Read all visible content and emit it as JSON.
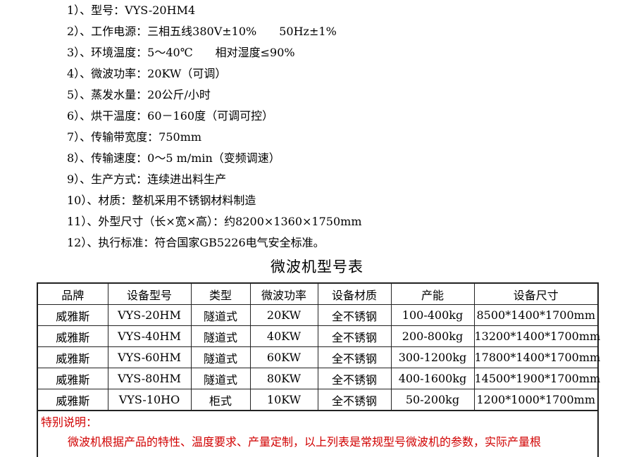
{
  "specs": [
    "1）、型号：VYS-20HM4",
    "2）、工作电源：三相五线380V±10%　　50Hz±1%",
    "3）、环境温度：5～40℃　　相对湿度≤90%",
    "4）、微波功率：20KW（可调）",
    "5）、蒸发水量：20公斤/小时",
    "6）、烘干温度：60－160度（可调可控）",
    "7）、传输带宽度：750mm",
    "8）、传输速度：0～5 m/min（变频调速）",
    "9）、生产方式：连续进出料生产",
    "10）、材质：整机采用不锈钢材料制造",
    "11）、外型尺寸（长×宽×高）：约8200×1360×1750mm",
    "12）、执行标准：符合国家GB5226电气安全标准。"
  ],
  "table_title": "微波机型号表",
  "table": {
    "headers": [
      "品牌",
      "设备型号",
      "类型",
      "微波功率",
      "设备材质",
      "产能",
      "设备尺寸"
    ],
    "rows": [
      [
        "威雅斯",
        "VYS-20HM",
        "隧道式",
        "20KW",
        "全不锈钢",
        "100-400kg",
        "8500*1400*1700mm"
      ],
      [
        "威雅斯",
        "VYS-40HM",
        "隧道式",
        "40KW",
        "全不锈钢",
        "200-800kg",
        "13200*1400*1700mm"
      ],
      [
        "威雅斯",
        "VYS-60HM",
        "隧道式",
        "60KW",
        "全不锈钢",
        "300-1200kg",
        "17800*1400*1700mm"
      ],
      [
        "威雅斯",
        "VYS-80HM",
        "隧道式",
        "80KW",
        "全不锈钢",
        "400-1600kg",
        "14500*1900*1700mm"
      ],
      [
        "威雅斯",
        "VYS-10HO",
        "柜式",
        "10KW",
        "全不锈钢",
        "50-200kg",
        "1200*1000*1700mm"
      ]
    ]
  },
  "note": {
    "title": "特别说明：",
    "text": "微波机根据产品的特性、温度要求、产量定制，以上列表是常规型号微波机的参数，实际产量根"
  },
  "colors": {
    "note_text": "#d10000",
    "border": "#222222"
  }
}
